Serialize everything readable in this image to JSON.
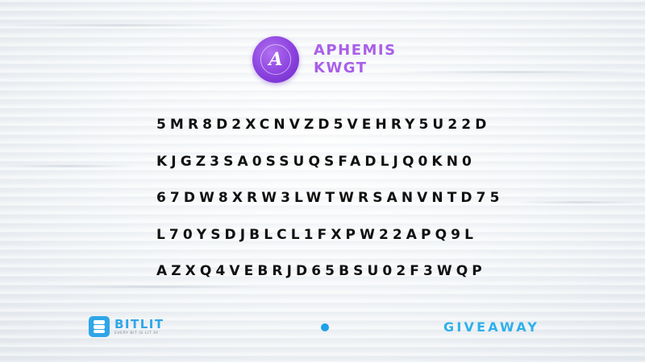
{
  "logo": {
    "letter": "A",
    "line1": "APHEMIS",
    "line2": "KWGT"
  },
  "codes": [
    "5MR8D2XCNVZD5VEHRY5U22D",
    "KJGZ3SA0SSUQSFADLJQ0KN0",
    "67DW8XRW3LWTWRSANVNTD75",
    "L70YSDJBLCL1FXPW22APQ9L",
    "AZXQ4VEBRJD65BSU02F3WQP"
  ],
  "brand": {
    "name": "BITLIT",
    "tagline": "EVERY BIT IS LIT AF"
  },
  "giveaway_label": "GIVEAWAY",
  "colors": {
    "purple": "#a95fe8",
    "blue": "#2fa6e8",
    "text": "#111111"
  }
}
